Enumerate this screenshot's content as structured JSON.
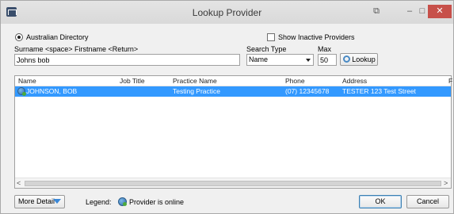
{
  "window": {
    "title": "Lookup Provider",
    "controls": {
      "pin": "⧉",
      "minimize": "–",
      "maximize": "□",
      "close": "✕"
    }
  },
  "search": {
    "directory_label": "Australian Directory",
    "show_inactive_label": "Show Inactive Providers",
    "name_hint": "Surname <space> Firstname <Return>",
    "name_value": "Johns bob",
    "search_type_label": "Search Type",
    "search_type_value": "Name",
    "max_label": "Max",
    "max_value": "50",
    "lookup_label": "Lookup"
  },
  "results": {
    "columns": [
      "Name",
      "Job Title",
      "Practice Name",
      "Phone",
      "Address",
      "F"
    ],
    "rows": [
      {
        "name": "JOHNSON, BOB",
        "job_title": "",
        "practice_name": "Testing Practice",
        "phone": "(07) 12345678",
        "address": "TESTER 123 Test Street",
        "status_icon": "provider-online-icon",
        "selected": true
      }
    ],
    "scroll_left": "<",
    "scroll_right": ">"
  },
  "footer": {
    "more_detail_label": "More Detail",
    "legend_label": "Legend:",
    "legend_item": "Provider is online",
    "ok_label": "OK",
    "cancel_label": "Cancel"
  },
  "colors": {
    "selection": "#3399ff",
    "close_button": "#c7504a"
  }
}
